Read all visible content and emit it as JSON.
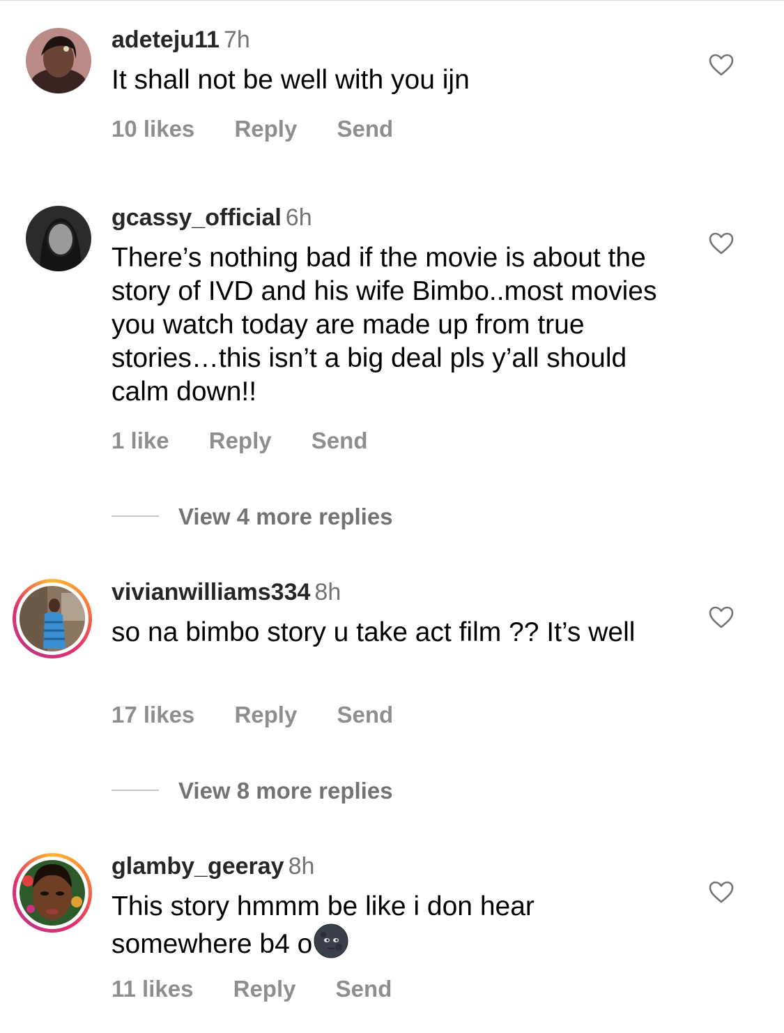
{
  "comments": [
    {
      "username": "adeteju11",
      "time": "7h",
      "text": "It shall not be well with you ijn",
      "likes": "10 likes",
      "reply": "Reply",
      "send": "Send"
    },
    {
      "username": "gcassy_official",
      "time": "6h",
      "text": "There’s nothing bad if the movie is about the story of IVD and his wife Bimbo..most movies you watch today are made up from true stories…this isn’t a big deal pls y’all should calm down!!",
      "likes": "1 like",
      "reply": "Reply",
      "send": "Send",
      "view_replies": "View 4 more replies"
    },
    {
      "username": "vivianwilliams334",
      "time": "8h",
      "text": "so na bimbo story u take act film ?? It’s well",
      "likes": "17 likes",
      "reply": "Reply",
      "send": "Send",
      "view_replies": "View 8 more replies"
    },
    {
      "username": "glamby_geeray",
      "time": "8h",
      "text": "This story hmmm be like i don hear somewhere b4 o",
      "emoji": "new-moon-face-emoji",
      "likes": "11 likes",
      "reply": "Reply",
      "send": "Send"
    }
  ],
  "icons": {
    "like": "heart-outline-icon"
  },
  "colors": {
    "meta_gray": "#8e8e8e",
    "story_ring_start": "#fdb931",
    "story_ring_end": "#c13584"
  }
}
